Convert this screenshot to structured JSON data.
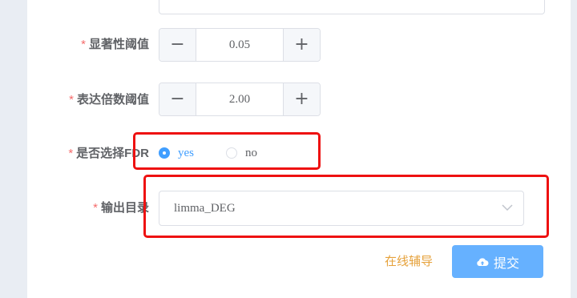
{
  "form": {
    "required_mark": "*",
    "significance": {
      "label": "显著性阈值",
      "value": "0.05",
      "minus": "−",
      "plus": "+"
    },
    "fold_change": {
      "label": "表达倍数阈值",
      "value": "2.00",
      "minus": "−",
      "plus": "+"
    },
    "fdr": {
      "label": "是否选择FDR",
      "options": [
        {
          "label": "yes",
          "checked": true
        },
        {
          "label": "no",
          "checked": false
        }
      ]
    },
    "output_dir": {
      "label": "输出目录",
      "value": "limma_DEG",
      "icon": "chevron-down-icon"
    }
  },
  "footer": {
    "assist_link": "在线辅导",
    "submit_label": "提交",
    "submit_icon": "cloud-upload-icon"
  },
  "colors": {
    "primary": "#409eff",
    "submit_bg": "#66b1ff",
    "required": "#f56c6c",
    "link": "#e6a23c",
    "highlight": "#ee1111"
  }
}
